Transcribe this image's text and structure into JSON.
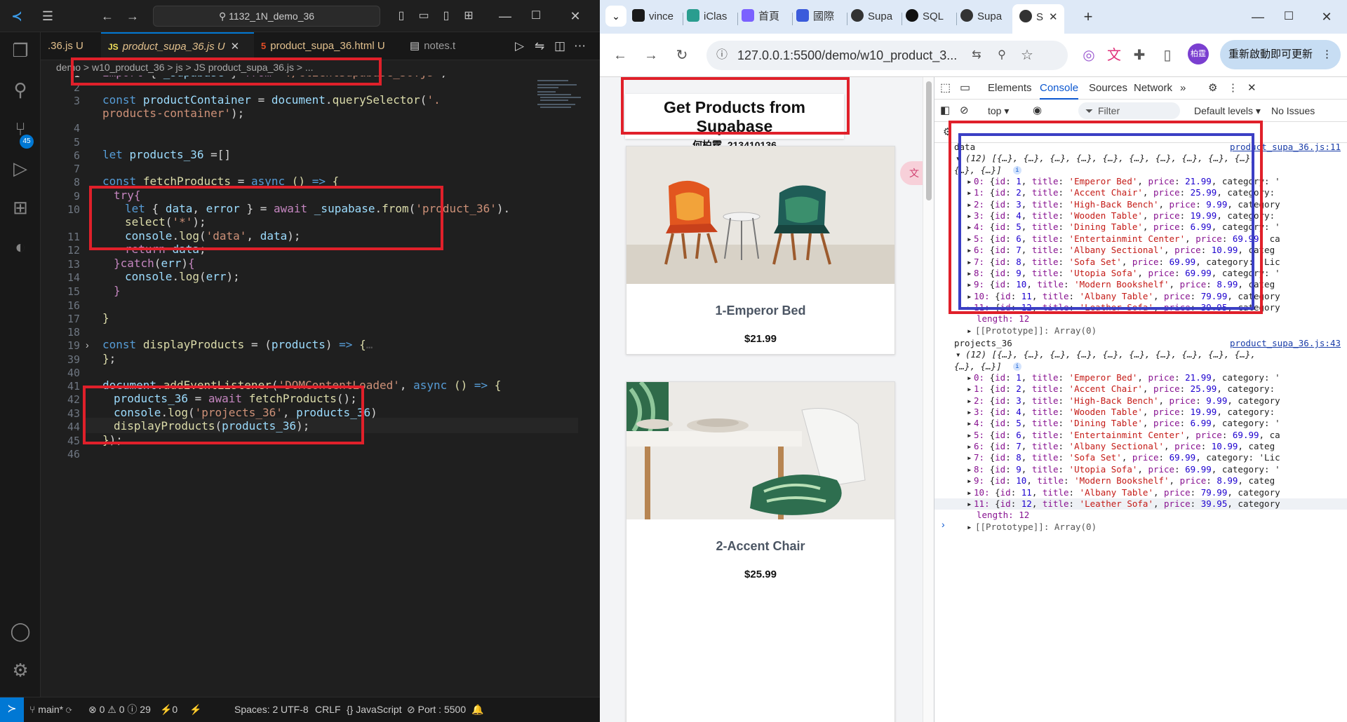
{
  "vscode": {
    "search_text": "1132_1N_demo_36",
    "tabs": [
      {
        "label": ".36.js U"
      },
      {
        "label": "product_supa_36.js U"
      },
      {
        "label": "product_supa_36.html U"
      },
      {
        "label": "notes.t"
      }
    ],
    "breadcrumb": "demo > w10_product_36 > js > JS product_supa_36.js > ...",
    "scm_badge": "45",
    "line_numbers": [
      "1",
      "2",
      "3",
      "",
      "4",
      "5",
      "6",
      "7",
      "8",
      "9",
      "10",
      "",
      "11",
      "12",
      "13",
      "14",
      "15",
      "16",
      "17",
      "18",
      "19",
      "39",
      "40",
      "41",
      "42",
      "43",
      "44",
      "45",
      "46"
    ],
    "status": {
      "branch": "main*",
      "problems": "⊗ 0 ⚠ 0 ⓘ 29",
      "ports": "⚡0",
      "spaces": "Spaces: 2",
      "encoding": "UTF-8",
      "eol": "CRLF",
      "language": "{} JavaScript",
      "port": "⊘ Port : 5500"
    }
  },
  "browser": {
    "tabs": [
      {
        "label": "vince",
        "color": "#1a1a1a"
      },
      {
        "label": "iClas",
        "color": "#2a9d8f"
      },
      {
        "label": "首頁",
        "color": "#7b61ff"
      },
      {
        "label": "國際",
        "color": "#3b5bdb"
      },
      {
        "label": "Supa",
        "color": "#333333"
      },
      {
        "label": "SQL",
        "color": "#111111"
      },
      {
        "label": "Supa",
        "color": "#333333"
      },
      {
        "label": "S",
        "color": "#333333"
      }
    ],
    "url": "127.0.0.1:5500/demo/w10_product_3...",
    "update_label": "重新啟動即可更新",
    "avatar": "柏霆",
    "page": {
      "title": "Get Products from Supabase",
      "subtitle": "何柏霆, 213410136",
      "products": [
        {
          "title": "1-Emperor Bed",
          "price": "$21.99"
        },
        {
          "title": "2-Accent Chair",
          "price": "$25.99"
        }
      ]
    },
    "devtools": {
      "tabs": [
        "Elements",
        "Console",
        "Sources",
        "Network"
      ],
      "context": "top ▾",
      "filter_placeholder": "Filter",
      "levels": "Default levels ▾",
      "issues": "No Issues",
      "logs": [
        {
          "label": "data",
          "source": "product_supa_36.js:11",
          "summary1": "(12) [{…}, {…}, {…}, {…}, {…}, {…}, {…}, {…}, {…}, {…},",
          "summary2": "{…}, {…}]",
          "rows": [
            {
              "i": "0",
              "id": "1",
              "title": "'Emperor Bed'",
              "price": "21.99",
              "tail": ", category: '"
            },
            {
              "i": "1",
              "id": "2",
              "title": "'Accent Chair'",
              "price": "25.99",
              "tail": ", category:"
            },
            {
              "i": "2",
              "id": "3",
              "title": "'High-Back Bench'",
              "price": "9.99",
              "tail": ", category"
            },
            {
              "i": "3",
              "id": "4",
              "title": "'Wooden Table'",
              "price": "19.99",
              "tail": ", category:"
            },
            {
              "i": "4",
              "id": "5",
              "title": "'Dining Table'",
              "price": "6.99",
              "tail": ", category: '"
            },
            {
              "i": "5",
              "id": "6",
              "title": "'Entertainmint Center'",
              "price": "69.99",
              "tail": ", ca"
            },
            {
              "i": "6",
              "id": "7",
              "title": "'Albany Sectional'",
              "price": "10.99",
              "tail": ", categ"
            },
            {
              "i": "7",
              "id": "8",
              "title": "'Sofa Set'",
              "price": "69.99",
              "tail": ", category: 'Lic"
            },
            {
              "i": "8",
              "id": "9",
              "title": "'Utopia Sofa'",
              "price": "69.99",
              "tail": ", category: '"
            },
            {
              "i": "9",
              "id": "10",
              "title": "'Modern Bookshelf'",
              "price": "8.99",
              "tail": ", categ"
            },
            {
              "i": "10",
              "id": "11",
              "title": "'Albany Table'",
              "price": "79.99",
              "tail": ", category"
            },
            {
              "i": "11",
              "id": "12",
              "title": "'Leather Sofa'",
              "price": "39.95",
              "tail": ", category"
            }
          ],
          "length": "length: 12",
          "proto": "[[Prototype]]: Array(0)"
        },
        {
          "label": "projects_36",
          "source": "product_supa_36.js:43",
          "summary1": "(12) [{…}, {…}, {…}, {…}, {…}, {…}, {…}, {…}, {…}, {…},",
          "summary2": "{…}, {…}]",
          "rows": [
            {
              "i": "0",
              "id": "1",
              "title": "'Emperor Bed'",
              "price": "21.99",
              "tail": ", category: '"
            },
            {
              "i": "1",
              "id": "2",
              "title": "'Accent Chair'",
              "price": "25.99",
              "tail": ", category:"
            },
            {
              "i": "2",
              "id": "3",
              "title": "'High-Back Bench'",
              "price": "9.99",
              "tail": ", category"
            },
            {
              "i": "3",
              "id": "4",
              "title": "'Wooden Table'",
              "price": "19.99",
              "tail": ", category:"
            },
            {
              "i": "4",
              "id": "5",
              "title": "'Dining Table'",
              "price": "6.99",
              "tail": ", category: '"
            },
            {
              "i": "5",
              "id": "6",
              "title": "'Entertainmint Center'",
              "price": "69.99",
              "tail": ", ca"
            },
            {
              "i": "6",
              "id": "7",
              "title": "'Albany Sectional'",
              "price": "10.99",
              "tail": ", categ"
            },
            {
              "i": "7",
              "id": "8",
              "title": "'Sofa Set'",
              "price": "69.99",
              "tail": ", category: 'Lic"
            },
            {
              "i": "8",
              "id": "9",
              "title": "'Utopia Sofa'",
              "price": "69.99",
              "tail": ", category: '"
            },
            {
              "i": "9",
              "id": "10",
              "title": "'Modern Bookshelf'",
              "price": "8.99",
              "tail": ", categ"
            },
            {
              "i": "10",
              "id": "11",
              "title": "'Albany Table'",
              "price": "79.99",
              "tail": ", category"
            },
            {
              "i": "11",
              "id": "12",
              "title": "'Leather Sofa'",
              "price": "39.95",
              "tail": ", category"
            }
          ],
          "length": "length: 12",
          "proto": "[[Prototype]]: Array(0)"
        }
      ]
    }
  }
}
